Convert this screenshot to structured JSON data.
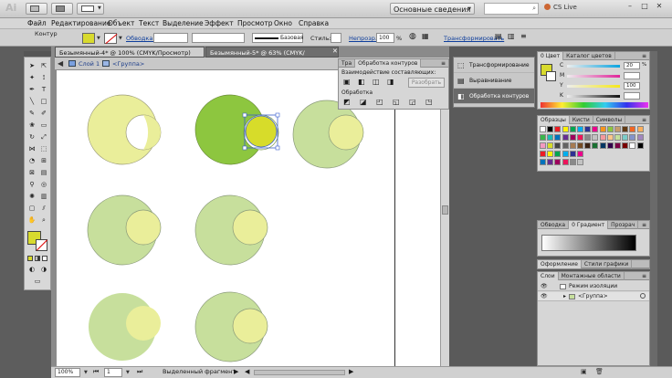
{
  "app": {
    "logo": "Ai",
    "workspace": "Основные сведения",
    "cslive": "CS Live",
    "window_buttons": [
      "–",
      "□",
      "✕"
    ]
  },
  "menu": [
    "Файл",
    "Редактирование",
    "Объект",
    "Текст",
    "Выделение",
    "Эффект",
    "Просмотр",
    "Окно",
    "Справка"
  ],
  "control_bar": {
    "mode_label": "Контур",
    "stroke_label": "Обводка:",
    "stroke_style": "Базовая",
    "style_label": "Стиль:",
    "opacity_label": "Непрозр.:",
    "opacity_value": "100",
    "opacity_unit": "%",
    "transform_label": "Трансформировать"
  },
  "tabs": [
    {
      "label": "Безымянный-4* @ 100% (CMYK/Просмотр)",
      "active": true
    },
    {
      "label": "Безымянный-5* @ 63% (CMYK/Просмотр)",
      "active": false
    }
  ],
  "breadcrumb": {
    "layer": "Слой 1",
    "group": "<Группа>"
  },
  "pathfinder": {
    "tab_inactive": "Тра",
    "title": "Обработка контуров",
    "shape_modes_label": "Взаимодействие составляющих:",
    "expand_button": "Разобрать",
    "pathfinders_label": "Обработка"
  },
  "collapsed_panels": {
    "items": [
      {
        "label": "Трансформирование",
        "icon": "transform-icon"
      },
      {
        "label": "Выравнивание",
        "icon": "align-icon"
      },
      {
        "label": "Обработка контуров",
        "icon": "pathfinder-icon",
        "selected": true
      }
    ]
  },
  "color_panel": {
    "tabs": [
      "0 Цвет",
      "Каталог цветов"
    ],
    "channels": [
      {
        "letter": "C",
        "value": "20"
      },
      {
        "letter": "M",
        "value": ""
      },
      {
        "letter": "Y",
        "value": "100"
      },
      {
        "letter": "K",
        "value": ""
      }
    ],
    "percent": "%",
    "fill_color": "#d8da2e"
  },
  "swatches_panel": {
    "tabs": [
      "Образцы",
      "Кисти",
      "Символы"
    ]
  },
  "gradient_panel": {
    "tabs": [
      "Обводка",
      "0 Градиент",
      "Прозрач"
    ]
  },
  "appearance_panel": {
    "tabs": [
      "Оформление",
      "Стили графики"
    ]
  },
  "layers_panel": {
    "tabs": [
      "Слои",
      "Монтажные области"
    ],
    "rows": [
      {
        "label": "Режим изоляции"
      },
      {
        "label": "<Группа>"
      }
    ]
  },
  "status": {
    "zoom": "100%",
    "page": "1",
    "tool_status": "Выделенный фрагмент"
  },
  "colors": {
    "pale_yellow": "#eaee9a",
    "pale_green": "#c7df9c",
    "bright_green": "#8dc63f",
    "bright_yellow": "#d7dc2a",
    "selection": "#3a5fcd"
  }
}
